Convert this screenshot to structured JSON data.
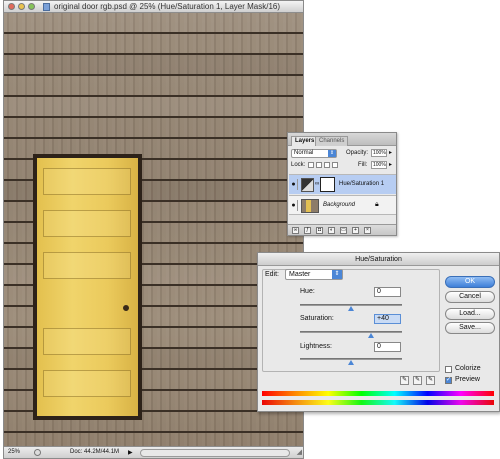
{
  "document": {
    "title": "original door rgb.psd @ 25% (Hue/Saturation 1, Layer Mask/16)",
    "zoom": "25%",
    "doc_size": "Doc: 44.2M/44.1M"
  },
  "layers_palette": {
    "tabs": [
      "Layers",
      "Channels"
    ],
    "blend_mode": "Normal",
    "opacity_label": "Opacity:",
    "opacity_value": "100%",
    "lock_label": "Lock:",
    "fill_label": "Fill:",
    "fill_value": "100%",
    "layers": [
      {
        "name": "Hue/Saturation 1",
        "selected": true
      },
      {
        "name": "Background",
        "selected": false
      }
    ]
  },
  "hue_saturation": {
    "title": "Hue/Saturation",
    "edit_label": "Edit:",
    "edit_value": "Master",
    "hue_label": "Hue:",
    "hue_value": "0",
    "hue_level": 0,
    "saturation_label": "Saturation:",
    "saturation_value": "+40",
    "saturation_level": 40,
    "lightness_label": "Lightness:",
    "lightness_value": "0",
    "lightness_level": 0,
    "buttons": {
      "ok": "OK",
      "cancel": "Cancel",
      "load": "Load...",
      "save": "Save..."
    },
    "colorize_label": "Colorize",
    "colorize_checked": false,
    "preview_label": "Preview",
    "preview_checked": true
  },
  "colors": {
    "accent": "#4b86d6",
    "door_yellow": "#ebca5c",
    "wood": "#8f7f6d"
  }
}
